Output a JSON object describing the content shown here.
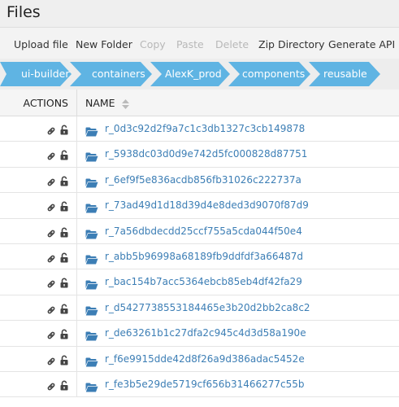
{
  "window": {
    "title": "Files"
  },
  "toolbar": {
    "upload": "Upload file",
    "new_folder": "New Folder",
    "copy": "Copy",
    "paste": "Paste",
    "delete": "Delete",
    "zip": "Zip Directory",
    "api": "Generate API Do"
  },
  "breadcrumb": [
    "ui-builder",
    "containers",
    "AlexK_prod",
    "components",
    "reusable"
  ],
  "colors": {
    "breadcrumb_fill": "#5fb4e3",
    "link": "#3c7eb5",
    "folder": "#3c7eb5",
    "disabled_text": "#b8b8b8"
  },
  "table": {
    "headers": {
      "actions": "ACTIONS",
      "name": "NAME"
    },
    "rows": [
      {
        "name": "r_0d3c92d2f9a7c1c3db1327c3cb149878"
      },
      {
        "name": "r_5938dc03d0d9e742d5fc000828d87751"
      },
      {
        "name": "r_6ef9f5e836acdb856fb31026c222737a"
      },
      {
        "name": "r_73ad49d1d18d39d4e8ded3d9070f87d9"
      },
      {
        "name": "r_7a56dbdecdd25ccf755a5cda044f50e4"
      },
      {
        "name": "r_abb5b96998a68189fb9ddfdf3a66487d"
      },
      {
        "name": "r_bac154b7acc5364ebcb85eb4df42fa29"
      },
      {
        "name": "r_d5427738553184465e3b20d2bb2ca8c2"
      },
      {
        "name": "r_de63261b1c27dfa2c945c4d3d58a190e"
      },
      {
        "name": "r_f6e9915dde42d8f26a9d386adac5452e"
      },
      {
        "name": "r_fe3b5e29de5719cf656b31466277c55b"
      }
    ]
  }
}
